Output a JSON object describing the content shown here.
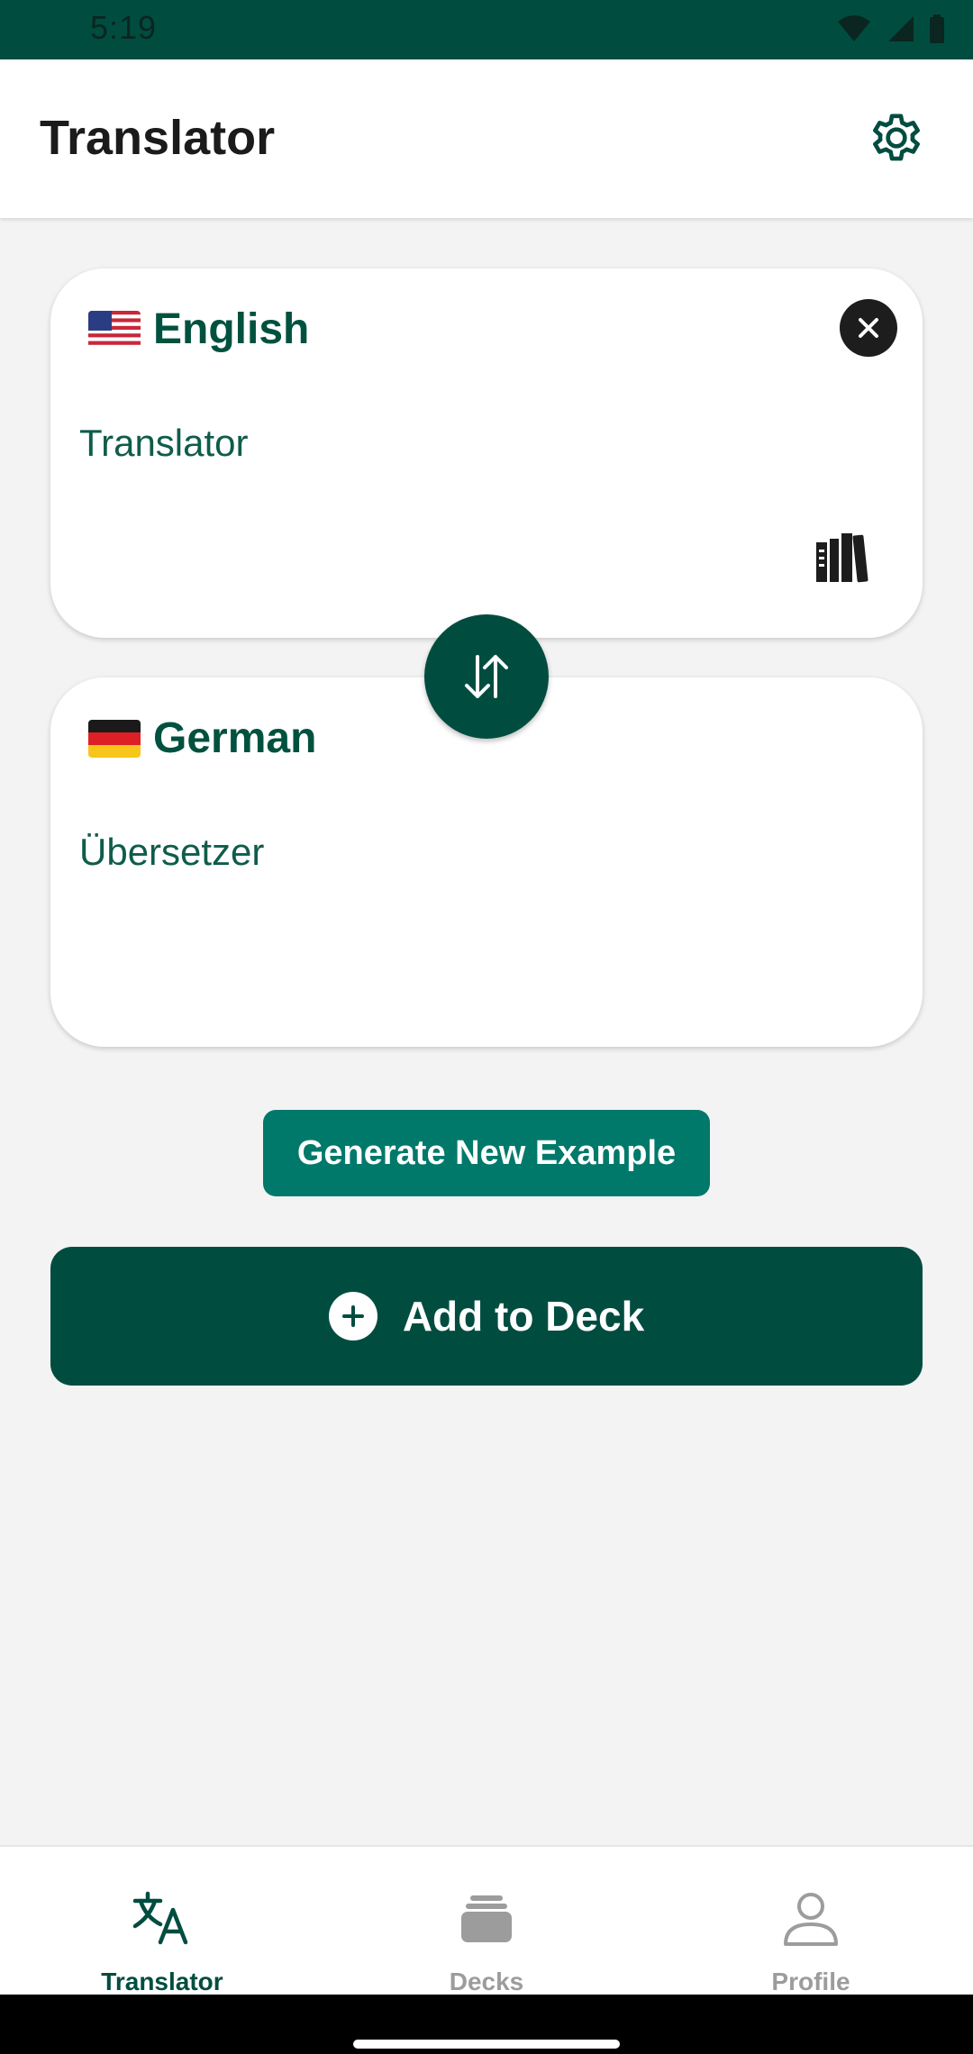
{
  "status_bar": {
    "time": "5:19"
  },
  "app_bar": {
    "title": "Translator",
    "settings_icon": "gear-icon"
  },
  "source_card": {
    "language": "English",
    "flag": "us-flag-icon",
    "text": "Translator",
    "clear_icon": "close-icon",
    "library_icon": "library-icon"
  },
  "swap_icon": "swap-vertical-icon",
  "target_card": {
    "language": "German",
    "flag": "de-flag-icon",
    "text": "Übersetzer"
  },
  "actions": {
    "generate_label": "Generate New Example",
    "add_label": "Add to Deck"
  },
  "bottom_nav": {
    "items": [
      {
        "label": "Translator",
        "icon": "translate-icon",
        "active": true
      },
      {
        "label": "Decks",
        "icon": "decks-icon",
        "active": false
      },
      {
        "label": "Profile",
        "icon": "person-icon",
        "active": false
      }
    ]
  },
  "colors": {
    "primary": "#004d40",
    "accent": "#00796b",
    "text_primary": "#00513f",
    "background": "#f3f3f3"
  }
}
